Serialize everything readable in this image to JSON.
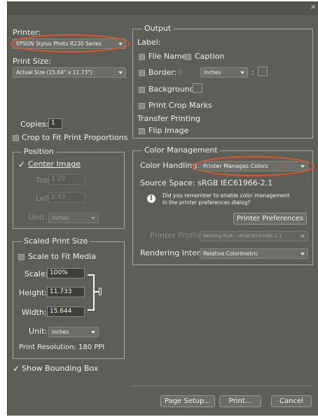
{
  "titlebar": {
    "close": "×"
  },
  "printer": {
    "label": "Printer:",
    "value": "EPSON Stylus Photo R230 Series"
  },
  "print_size": {
    "label": "Print Size:",
    "value": "Actual Size (15.64\" x 11.73\")"
  },
  "copies": {
    "label": "Copies:",
    "value": "1"
  },
  "crop_to_fit": {
    "label": "Crop to Fit Print Proportions"
  },
  "position": {
    "legend": "Position",
    "center_image": "Center Image",
    "top_label": "Top:",
    "top_value": "1.29",
    "left_label": "Left:",
    "left_value": "2.43",
    "unit_label": "Unit:",
    "unit_value": "inches"
  },
  "scaled": {
    "legend": "Scaled Print Size",
    "scale_to_fit": "Scale to Fit Media",
    "scale_label": "Scale:",
    "scale_value": "100%",
    "height_label": "Height:",
    "height_value": "11.733",
    "width_label": "Width:",
    "width_value": "15.644",
    "unit_label": "Unit:",
    "unit_value": "inches",
    "resolution": "Print Resolution: 180 PPI"
  },
  "show_bounding_box": "Show Bounding Box",
  "output": {
    "legend": "Output",
    "label_heading": "Label:",
    "file_name": "File Name",
    "caption": "Caption",
    "border_label": "Border:",
    "border_value": "0",
    "border_unit": "inches",
    "border_colon": ":",
    "background": "Background:",
    "print_crop_marks": "Print Crop Marks",
    "transfer_printing": "Transfer Printing",
    "flip_image": "Flip Image"
  },
  "color_mgmt": {
    "legend": "Color Management",
    "handling_label": "Color Handling:",
    "handling_value": "Printer Manages Colors",
    "source_space": "Source Space:  sRGB IEC61966-2.1",
    "reminder_line1": "Did you remember to enable color management",
    "reminder_line2": "in the printer preferences dialog?",
    "printer_preferences": "Printer Preferences",
    "profile_label": "Printer Profile:",
    "profile_value": "Working RGB - sRGB IEC61966-2.1",
    "intent_label": "Rendering Intent:",
    "intent_value": "Relative Colorimetric"
  },
  "buttons": {
    "page_setup": "Page Setup...",
    "print": "Print...",
    "cancel": "Cancel"
  }
}
